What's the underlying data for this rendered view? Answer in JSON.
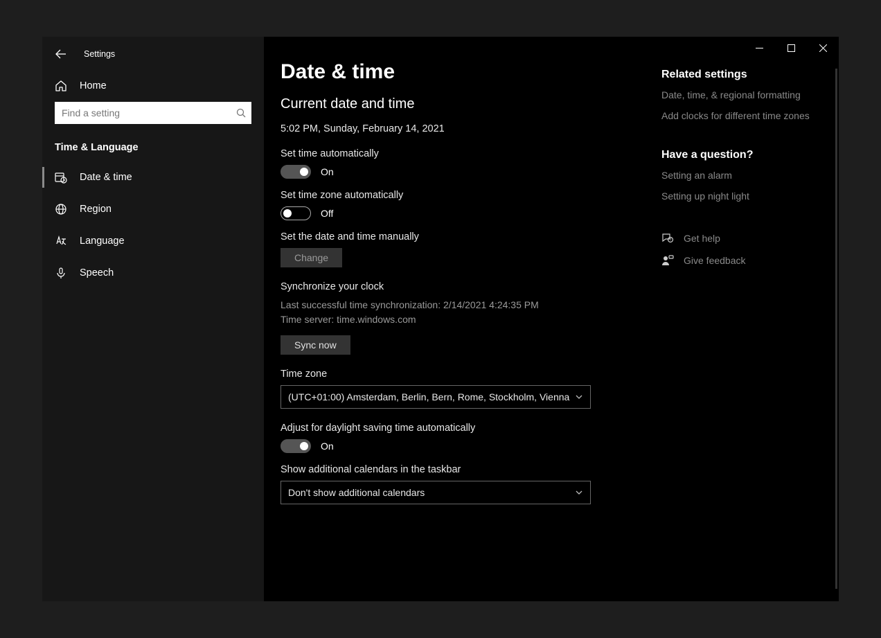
{
  "app_title": "Settings",
  "titlebar": {
    "minimize": "minimize",
    "maximize": "maximize",
    "close": "close"
  },
  "sidebar": {
    "home_label": "Home",
    "search_placeholder": "Find a setting",
    "section_title": "Time & Language",
    "items": [
      {
        "label": "Date & time",
        "active": true
      },
      {
        "label": "Region",
        "active": false
      },
      {
        "label": "Language",
        "active": false
      },
      {
        "label": "Speech",
        "active": false
      }
    ]
  },
  "main": {
    "page_title": "Date & time",
    "current_heading": "Current date and time",
    "current_value": "5:02 PM, Sunday, February 14, 2021",
    "set_time_auto_label": "Set time automatically",
    "set_time_auto_state": "On",
    "set_timezone_auto_label": "Set time zone automatically",
    "set_timezone_auto_state": "Off",
    "set_manual_label": "Set the date and time manually",
    "change_button": "Change",
    "sync_heading": "Synchronize your clock",
    "sync_last": "Last successful time synchronization: 2/14/2021 4:24:35 PM",
    "sync_server": "Time server: time.windows.com",
    "sync_button": "Sync now",
    "timezone_label": "Time zone",
    "timezone_value": "(UTC+01:00) Amsterdam, Berlin, Bern, Rome, Stockholm, Vienna",
    "dst_label": "Adjust for daylight saving time automatically",
    "dst_state": "On",
    "additional_calendars_label": "Show additional calendars in the taskbar",
    "additional_calendars_value": "Don't show additional calendars"
  },
  "rail": {
    "related_heading": "Related settings",
    "related_links": [
      "Date, time, & regional formatting",
      "Add clocks for different time zones"
    ],
    "question_heading": "Have a question?",
    "question_links": [
      "Setting an alarm",
      "Setting up night light"
    ],
    "get_help": "Get help",
    "give_feedback": "Give feedback"
  }
}
